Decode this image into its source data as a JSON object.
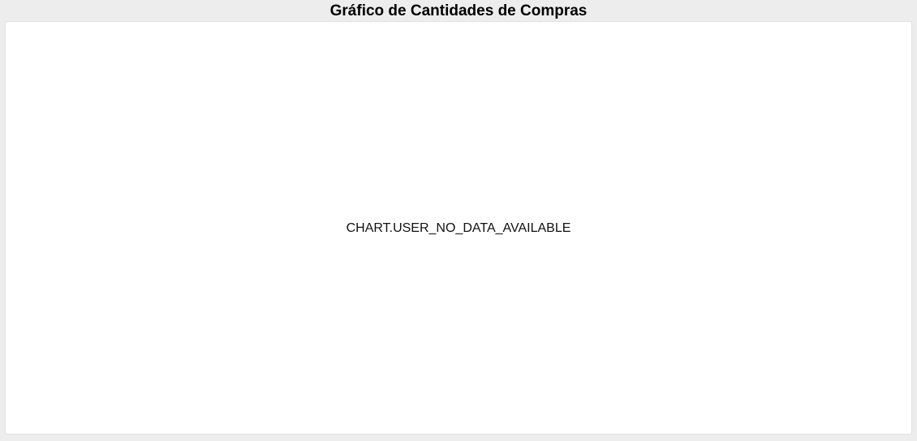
{
  "chart": {
    "title": "Gráfico de Cantidades de Compras",
    "empty_message": "CHART.USER_NO_DATA_AVAILABLE"
  },
  "colors": {
    "page_background": "#ededed",
    "panel_background": "#ffffff",
    "text": "#000000"
  }
}
